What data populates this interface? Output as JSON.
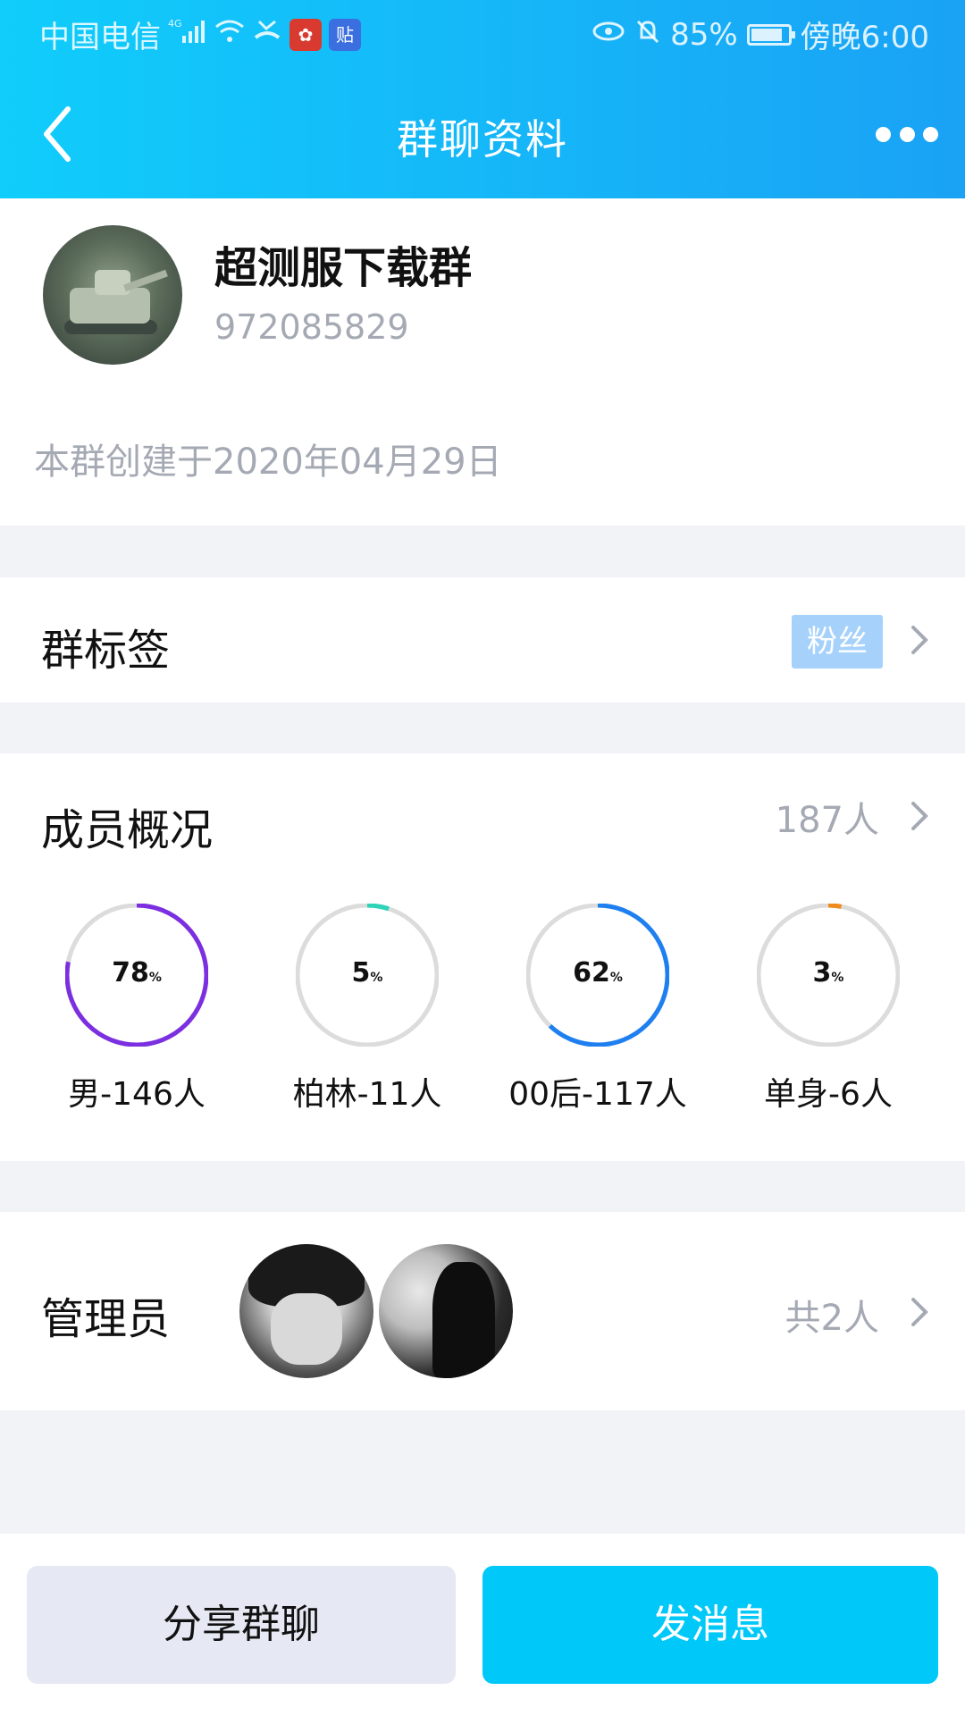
{
  "status_bar": {
    "carrier": "中国电信",
    "network": "4G",
    "battery_percent": "85%",
    "time": "傍晚6:00",
    "notifications": [
      "huawei-app-icon",
      "tieba-app-icon"
    ],
    "tieba_badge_text": "贴"
  },
  "nav": {
    "title": "群聊资料"
  },
  "group": {
    "name": "超测服下载群",
    "id": "972085829",
    "created": "本群创建于2020年04月29日"
  },
  "tags": {
    "title": "群标签",
    "chip": "粉丝"
  },
  "members": {
    "title": "成员概况",
    "count": "187人",
    "stats": [
      {
        "percent": 78,
        "percent_label": "78",
        "label": "男-146人",
        "color": "#7b2fe0"
      },
      {
        "percent": 5,
        "percent_label": "5",
        "label": "柏林-11人",
        "color": "#2dd4b8"
      },
      {
        "percent": 62,
        "percent_label": "62",
        "label": "00后-117人",
        "color": "#1e7ff0"
      },
      {
        "percent": 3,
        "percent_label": "3",
        "label": "单身-6人",
        "color": "#f08a1c"
      }
    ],
    "percent_unit": "%"
  },
  "admins": {
    "title": "管理员",
    "count": "共2人"
  },
  "bottom": {
    "share_label": "分享群聊",
    "send_label": "发消息"
  },
  "colors": {
    "header_start": "#10cdfb",
    "header_end": "#1aa2f5",
    "send_button": "#00c8f8",
    "tag_chip": "#a6d1fb"
  }
}
